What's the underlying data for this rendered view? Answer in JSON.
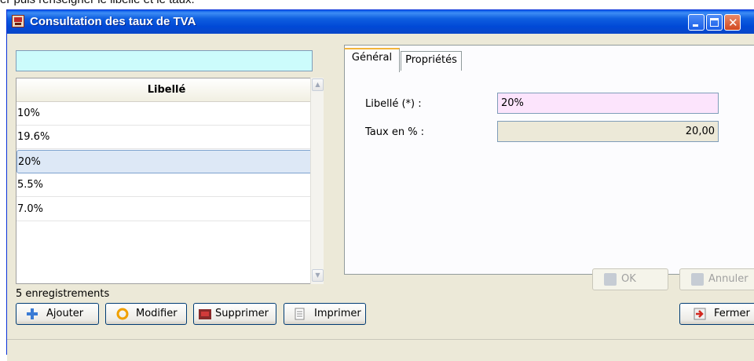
{
  "caption_text": "er puis renseigner le libellé et le taux.",
  "window": {
    "title": "Consultation des taux de TVA"
  },
  "search": {
    "value": ""
  },
  "grid": {
    "header": "Libellé",
    "rows": [
      "10%",
      "19.6%",
      "20%",
      "5.5%",
      "7.0%"
    ],
    "selected_index": 2
  },
  "record_count": "5 enregistrements",
  "tabs": [
    "Général",
    "Propriétés"
  ],
  "form": {
    "libelle_label": "Libellé (*) :",
    "libelle_value": "20%",
    "taux_label": "Taux en % :",
    "taux_value": "20,00"
  },
  "actions": {
    "ok": "OK",
    "annuler": "Annuler"
  },
  "toolbar": {
    "ajouter": "Ajouter",
    "modifier": "Modifier",
    "supprimer": "Supprimer",
    "imprimer": "Imprimer",
    "fermer": "Fermer"
  },
  "colors": {
    "search_bg": "#ccfcfc",
    "required_field_bg": "#fce4fc",
    "readonly_field_bg": "#ece9d8",
    "selected_row": "#dde8f6",
    "titlebar": "#0a47c8"
  }
}
